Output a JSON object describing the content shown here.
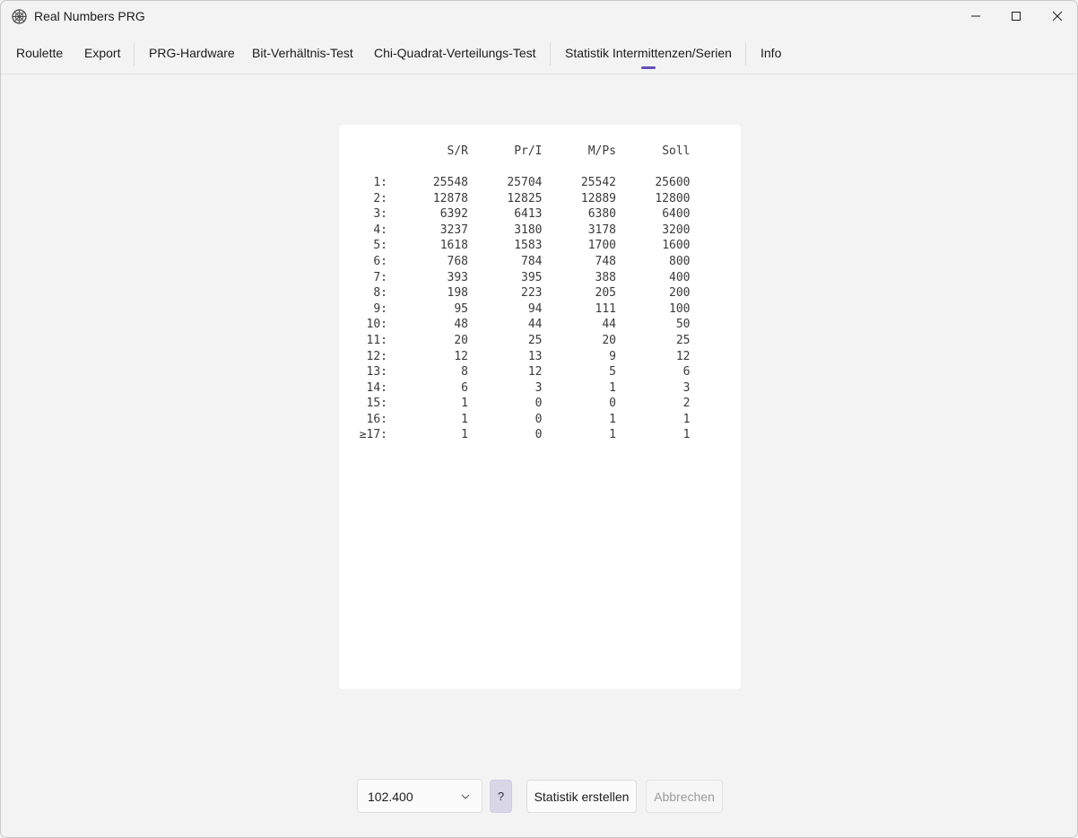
{
  "window": {
    "title": "Real Numbers PRG"
  },
  "tabs": [
    {
      "label": "Roulette"
    },
    {
      "label": "Export"
    },
    {
      "label": "PRG-Hardware"
    },
    {
      "label": "Bit-Verhältnis-Test"
    },
    {
      "label": "Chi-Quadrat-Verteilungs-Test"
    },
    {
      "label": "Statistik Intermittenzen/Serien",
      "selected": true
    },
    {
      "label": "Info"
    }
  ],
  "stats": {
    "headers": [
      "",
      "S/R",
      "Pr/I",
      "M/Ps",
      "Soll"
    ],
    "rows": [
      [
        "1:",
        "25548",
        "25704",
        "25542",
        "25600"
      ],
      [
        "2:",
        "12878",
        "12825",
        "12889",
        "12800"
      ],
      [
        "3:",
        "6392",
        "6413",
        "6380",
        "6400"
      ],
      [
        "4:",
        "3237",
        "3180",
        "3178",
        "3200"
      ],
      [
        "5:",
        "1618",
        "1583",
        "1700",
        "1600"
      ],
      [
        "6:",
        "768",
        "784",
        "748",
        "800"
      ],
      [
        "7:",
        "393",
        "395",
        "388",
        "400"
      ],
      [
        "8:",
        "198",
        "223",
        "205",
        "200"
      ],
      [
        "9:",
        "95",
        "94",
        "111",
        "100"
      ],
      [
        "10:",
        "48",
        "44",
        "44",
        "50"
      ],
      [
        "11:",
        "20",
        "25",
        "20",
        "25"
      ],
      [
        "12:",
        "12",
        "13",
        "9",
        "12"
      ],
      [
        "13:",
        "8",
        "12",
        "5",
        "6"
      ],
      [
        "14:",
        "6",
        "3",
        "1",
        "3"
      ],
      [
        "15:",
        "1",
        "0",
        "0",
        "2"
      ],
      [
        "16:",
        "1",
        "0",
        "1",
        "1"
      ],
      [
        "≥17:",
        "1",
        "0",
        "1",
        "1"
      ]
    ]
  },
  "controls": {
    "count_select": "102.400",
    "help_label": "?",
    "create_label": "Statistik erstellen",
    "cancel_label": "Abbrechen"
  },
  "colors": {
    "accent": "#6650b4",
    "background": "#f3f3f3",
    "panel": "#ffffff"
  }
}
